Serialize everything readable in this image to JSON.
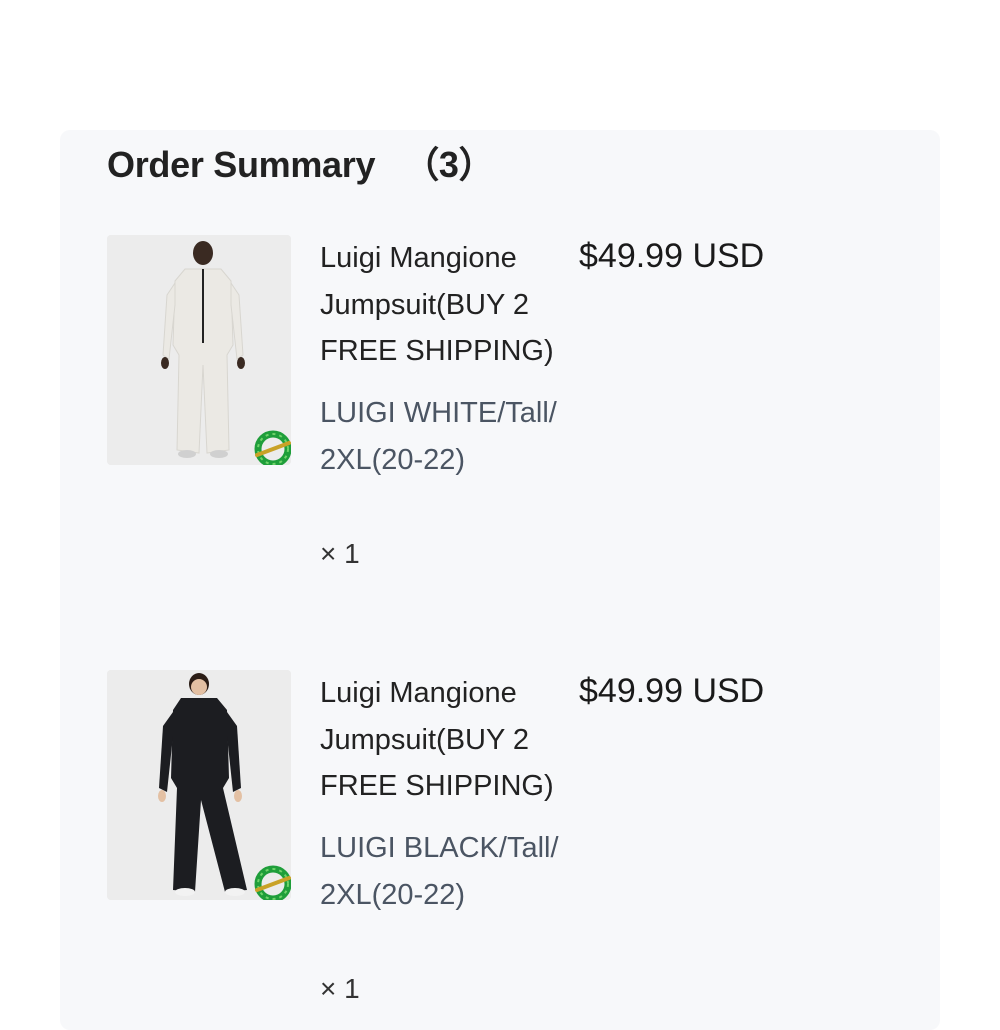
{
  "summary": {
    "title": "Order Summary",
    "count": "（3）"
  },
  "items": [
    {
      "name": "Luigi Mangione Jumpsuit(BUY 2 FREE SHIPPING)",
      "variant": "LUIGI WHITE/Tall/2XL(20-22)",
      "quantity": "× 1",
      "price": "$49.99 USD",
      "garment_color": "#e9e7e2",
      "badge_icon": "green-ring-badge-icon"
    },
    {
      "name": "Luigi Mangione Jumpsuit(BUY 2 FREE SHIPPING)",
      "variant": "LUIGI BLACK/Tall/2XL(20-22)",
      "quantity": "× 1",
      "price": "$49.99 USD",
      "garment_color": "#1c1d21",
      "badge_icon": "green-ring-badge-icon"
    }
  ],
  "colors": {
    "panel_bg": "#f7f8fa",
    "text_primary": "#222222",
    "text_secondary": "#4b5563"
  }
}
